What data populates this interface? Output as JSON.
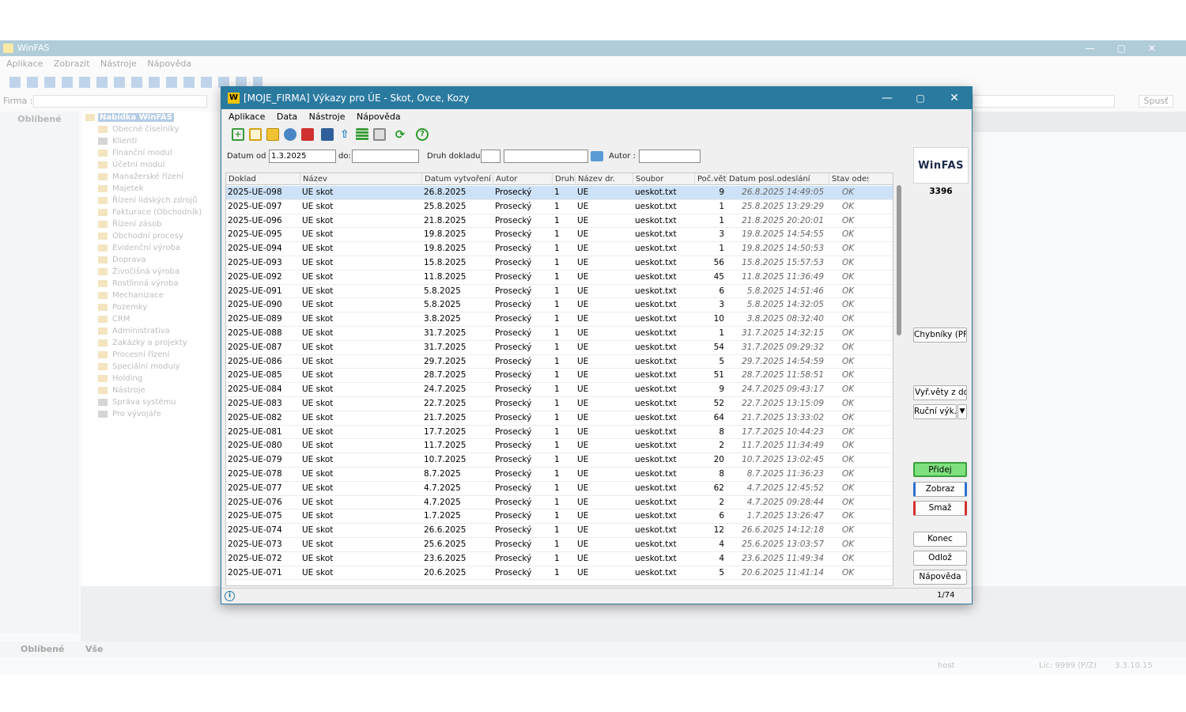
{
  "bg": {
    "title": "WinFAS",
    "menu": [
      "Aplikace",
      "Zobrazit",
      "Nástroje",
      "Nápověda"
    ],
    "firma_label": "Firma :",
    "spust": "Spusť",
    "left_head": "Oblíbené",
    "tree": [
      "Nabídka WinFAS",
      "Obecné číselníky",
      "Klienti",
      "Finanční modul",
      "Účetní modul",
      "Manažerské řízení",
      "Majetek",
      "Řízení lidských zdrojů",
      "Fakturace (Obchodník)",
      "Řízení zásob",
      "Obchodní procesy",
      "Evidenční výroba",
      "Doprava",
      "Živočišná výroba",
      "Rostlinná výroba",
      "Mechanizace",
      "Pozemky",
      "CRM",
      "Administrativa",
      "Zakázky a projekty",
      "Procesní řízení",
      "Speciální moduly",
      "Holding",
      "Nástroje",
      "Správa systému",
      "Pro vývojáře"
    ],
    "tab_oblibene": "Oblíbené",
    "tab_vse": "Vše",
    "status_host": "host",
    "status_lic": "Lic: 9999 (P/Z)",
    "status_ver": "3.3.10.15"
  },
  "dialog": {
    "title": "[MOJE_FIRMA] Výkazy pro ÚE - Skot, Ovce, Kozy",
    "menu": [
      "Aplikace",
      "Data",
      "Nástroje",
      "Nápověda"
    ],
    "filter": {
      "datum_od_label": "Datum od :",
      "datum_od_value": "1.3.2025",
      "do_label": "do:",
      "do_value": "",
      "druh_label": "Druh dokladu :",
      "autor_label": "Autor :"
    },
    "columns": [
      "Doklad",
      "Název",
      "Datum vytvoření",
      "Autor",
      "Druh",
      "Název dr.",
      "Soubor",
      "Poč.vět",
      "Datum posl.odeslání",
      "Stav odesl."
    ],
    "rows": [
      [
        "2025-UE-098",
        "UE skot",
        "26.8.2025",
        "Prosecký",
        "1",
        "UE",
        "ueskot.txt",
        "9",
        "26.8.2025 14:49:05",
        "OK"
      ],
      [
        "2025-UE-097",
        "UE skot",
        "25.8.2025",
        "Prosecký",
        "1",
        "UE",
        "ueskot.txt",
        "1",
        "25.8.2025 13:29:29",
        "OK"
      ],
      [
        "2025-UE-096",
        "UE skot",
        "21.8.2025",
        "Prosecký",
        "1",
        "UE",
        "ueskot.txt",
        "1",
        "21.8.2025 20:20:01",
        "OK"
      ],
      [
        "2025-UE-095",
        "UE skot",
        "19.8.2025",
        "Prosecký",
        "1",
        "UE",
        "ueskot.txt",
        "3",
        "19.8.2025 14:54:55",
        "OK"
      ],
      [
        "2025-UE-094",
        "UE skot",
        "19.8.2025",
        "Prosecký",
        "1",
        "UE",
        "ueskot.txt",
        "1",
        "19.8.2025 14:50:53",
        "OK"
      ],
      [
        "2025-UE-093",
        "UE skot",
        "15.8.2025",
        "Prosecký",
        "1",
        "UE",
        "ueskot.txt",
        "56",
        "15.8.2025 15:57:53",
        "OK"
      ],
      [
        "2025-UE-092",
        "UE skot",
        "11.8.2025",
        "Prosecký",
        "1",
        "UE",
        "ueskot.txt",
        "45",
        "11.8.2025 11:36:49",
        "OK"
      ],
      [
        "2025-UE-091",
        "UE skot",
        "5.8.2025",
        "Prosecký",
        "1",
        "UE",
        "ueskot.txt",
        "6",
        "5.8.2025 14:51:46",
        "OK"
      ],
      [
        "2025-UE-090",
        "UE skot",
        "5.8.2025",
        "Prosecký",
        "1",
        "UE",
        "ueskot.txt",
        "3",
        "5.8.2025 14:32:05",
        "OK"
      ],
      [
        "2025-UE-089",
        "UE skot",
        "3.8.2025",
        "Prosecký",
        "1",
        "UE",
        "ueskot.txt",
        "10",
        "3.8.2025 08:32:40",
        "OK"
      ],
      [
        "2025-UE-088",
        "UE skot",
        "31.7.2025",
        "Prosecký",
        "1",
        "UE",
        "ueskot.txt",
        "1",
        "31.7.2025 14:32:15",
        "OK"
      ],
      [
        "2025-UE-087",
        "UE skot",
        "31.7.2025",
        "Prosecký",
        "1",
        "UE",
        "ueskot.txt",
        "54",
        "31.7.2025 09:29:32",
        "OK"
      ],
      [
        "2025-UE-086",
        "UE skot",
        "29.7.2025",
        "Prosecký",
        "1",
        "UE",
        "ueskot.txt",
        "5",
        "29.7.2025 14:54:59",
        "OK"
      ],
      [
        "2025-UE-085",
        "UE skot",
        "28.7.2025",
        "Prosecký",
        "1",
        "UE",
        "ueskot.txt",
        "51",
        "28.7.2025 11:58:51",
        "OK"
      ],
      [
        "2025-UE-084",
        "UE skot",
        "24.7.2025",
        "Prosecký",
        "1",
        "UE",
        "ueskot.txt",
        "9",
        "24.7.2025 09:43:17",
        "OK"
      ],
      [
        "2025-UE-083",
        "UE skot",
        "22.7.2025",
        "Prosecký",
        "1",
        "UE",
        "ueskot.txt",
        "52",
        "22.7.2025 13:15:09",
        "OK"
      ],
      [
        "2025-UE-082",
        "UE skot",
        "21.7.2025",
        "Prosecký",
        "1",
        "UE",
        "ueskot.txt",
        "64",
        "21.7.2025 13:33:02",
        "OK"
      ],
      [
        "2025-UE-081",
        "UE skot",
        "17.7.2025",
        "Prosecký",
        "1",
        "UE",
        "ueskot.txt",
        "8",
        "17.7.2025 10:44:23",
        "OK"
      ],
      [
        "2025-UE-080",
        "UE skot",
        "11.7.2025",
        "Prosecký",
        "1",
        "UE",
        "ueskot.txt",
        "2",
        "11.7.2025 11:34:49",
        "OK"
      ],
      [
        "2025-UE-079",
        "UE skot",
        "10.7.2025",
        "Prosecký",
        "1",
        "UE",
        "ueskot.txt",
        "20",
        "10.7.2025 13:02:45",
        "OK"
      ],
      [
        "2025-UE-078",
        "UE skot",
        "8.7.2025",
        "Prosecký",
        "1",
        "UE",
        "ueskot.txt",
        "8",
        "8.7.2025 11:36:23",
        "OK"
      ],
      [
        "2025-UE-077",
        "UE skot",
        "4.7.2025",
        "Prosecký",
        "1",
        "UE",
        "ueskot.txt",
        "62",
        "4.7.2025 12:45:52",
        "OK"
      ],
      [
        "2025-UE-076",
        "UE skot",
        "4.7.2025",
        "Prosecký",
        "1",
        "UE",
        "ueskot.txt",
        "2",
        "4.7.2025 09:28:44",
        "OK"
      ],
      [
        "2025-UE-075",
        "UE skot",
        "1.7.2025",
        "Prosecký",
        "1",
        "UE",
        "ueskot.txt",
        "6",
        "1.7.2025 13:26:47",
        "OK"
      ],
      [
        "2025-UE-074",
        "UE skot",
        "26.6.2025",
        "Prosecký",
        "1",
        "UE",
        "ueskot.txt",
        "12",
        "26.6.2025 14:12:18",
        "OK"
      ],
      [
        "2025-UE-073",
        "UE skot",
        "25.6.2025",
        "Prosecký",
        "1",
        "UE",
        "ueskot.txt",
        "4",
        "25.6.2025 13:03:57",
        "OK"
      ],
      [
        "2025-UE-072",
        "UE skot",
        "23.6.2025",
        "Prosecký",
        "1",
        "UE",
        "ueskot.txt",
        "4",
        "23.6.2025 11:49:34",
        "OK"
      ],
      [
        "2025-UE-071",
        "UE skot",
        "20.6.2025",
        "Prosecký",
        "1",
        "UE",
        "ueskot.txt",
        "5",
        "20.6.2025 11:41:14",
        "OK"
      ]
    ],
    "side": {
      "brand": "WinFAS",
      "count": "3396",
      "chybniky": "Chybníky (PF)",
      "vyr_vety": "Vyř.věty z dok.",
      "rucni": "Ruční výk.",
      "pridej": "Přidej",
      "zobraz": "Zobraz",
      "smaz": "Smaž",
      "konec": "Konec",
      "odloz": "Odlož",
      "napoveda": "Nápověda"
    },
    "page_info": "1/74",
    "colors": {
      "accent": "#2a7aa0",
      "selected_row": "#cde2f7",
      "add": "#7fe07f",
      "view": "#2f6fd0",
      "delete": "#d03030"
    }
  }
}
